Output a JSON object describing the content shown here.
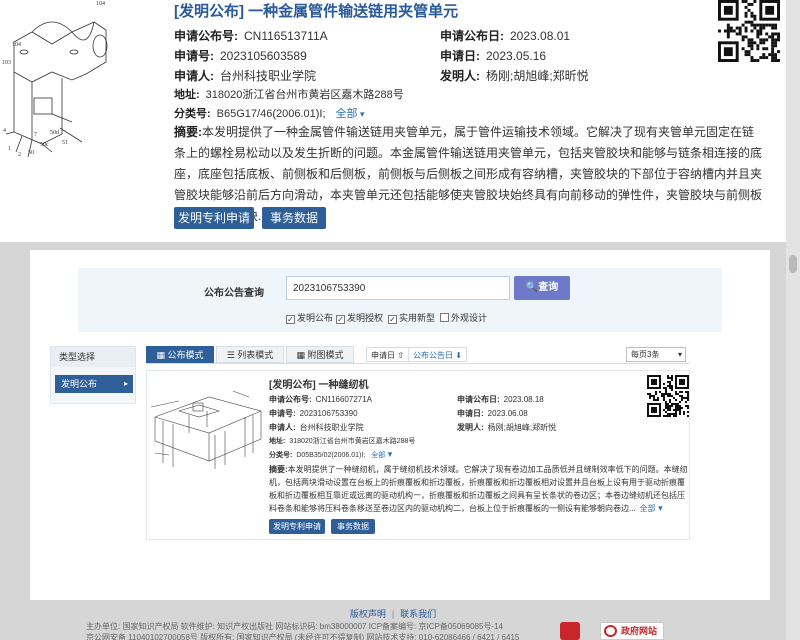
{
  "top": {
    "title": "[发明公布] 一种金属管件输送链用夹管单元",
    "pub_no_label": "申请公布号:",
    "pub_no": "CN116513711A",
    "pub_date_label": "申请公布日:",
    "pub_date": "2023.08.01",
    "app_no_label": "申请号:",
    "app_no": "2023105603589",
    "app_date_label": "申请日:",
    "app_date": "2023.05.16",
    "applicant_label": "申请人:",
    "applicant": "台州科技职业学院",
    "inventor_label": "发明人:",
    "inventor": "杨刚;胡旭峰;郑昕悦",
    "address_label": "地址:",
    "address": "318020浙江省台州市黄岩区嘉木路288号",
    "class_label": "分类号:",
    "class": "B65G17/46(2006.01)I;",
    "expand_all": "全部",
    "abstract_label": "摘要:",
    "abstract": "本发明提供了一种金属管件输送链用夹管单元，属于管件运输技术领域。它解决了现有夹管单元固定在链条上的螺栓易松动以及发生折断的问题。本金属管件输送链用夹管单元，包括夹管胶块和能够与链条相连接的底座，底座包括底板、前侧板和后侧板，前侧板与后侧板之间形成有容纳槽，夹管胶块的下部位于容纳槽内并且夹管胶块能够沿前后方向滑动，本夹管单元还包括能够使夹管胶块始终具有向前移动的弹性件，夹管胶块与前侧板相贴，夹管胶块...",
    "abstract_expand": "全部",
    "btn_apply": "发明专利申请",
    "btn_affairs": "事务数据",
    "diagram_labels": [
      "104",
      "104",
      "103",
      "4",
      "50d",
      "50c",
      "51",
      "2",
      "1",
      "50",
      "7"
    ]
  },
  "search": {
    "label": "公布公告查询",
    "value": "2023106753390",
    "button": "查询",
    "options": [
      {
        "label": "发明公布",
        "checked": true
      },
      {
        "label": "发明授权",
        "checked": true
      },
      {
        "label": "实用新型",
        "checked": true
      },
      {
        "label": "外观设计",
        "checked": false
      }
    ]
  },
  "sidebar": {
    "heading": "类型选择",
    "item": "发明公布"
  },
  "toolbar": {
    "tabs": [
      "公布模式",
      "列表模式",
      "附图模式"
    ],
    "sort_app_date": "申请日",
    "sort_pub_date": "公布公告日",
    "per_page": "每页3条"
  },
  "result": {
    "title": "[发明公布] 一种缝纫机",
    "pub_no_label": "申请公布号:",
    "pub_no": "CN116607271A",
    "pub_date_label": "申请公布日:",
    "pub_date": "2023.08.18",
    "app_no_label": "申请号:",
    "app_no": "2023106753390",
    "app_date_label": "申请日:",
    "app_date": "2023.06.08",
    "applicant_label": "申请人:",
    "applicant": "台州科技职业学院",
    "inventor_label": "发明人:",
    "inventor": "杨刚;胡旭峰;郑昕悦",
    "address_label": "地址:",
    "address": "318020浙江省台州市黄岩区嘉木路288号",
    "class_label": "分类号:",
    "class": "D05B35/02(2006.01)I;",
    "expand_all": "全部",
    "abstract_label": "摘要:",
    "abstract": "本发明提供了一种缝纫机，属于缝纫机技术领域。它解决了现有卷边加工品质低并且缝制效率低下的问题。本缝纫机，包括两块滑动设置在台板上的折痕覆板和折边覆板，折痕覆板和折边覆板相对设置并且台板上设有用于驱动折痕覆板和折边覆板相互靠近或远离的驱动机构一，折痕覆板和折边覆板之间具有呈长条状的卷边区；本卷边缝纫机还包括压料卷条和能够将压料卷条移送至卷边区内的驱动机构二，台板上位于折痕覆板的一侧设有能够朝向卷边...",
    "abstract_expand": "全部",
    "btn_apply": "发明专利申请",
    "btn_affairs": "事务数据"
  },
  "footer": {
    "link_copyright": "版权声明",
    "link_contact": "联系我们",
    "line1": "主办单位: 国家知识产权局   软件维护: 知识产权出版社   网站标识码: bm38000007   ICP备案编号: 京ICP备05069085号-14",
    "line2": "京公网安备 11040102700058号   版权所有: 国家知识产权局 (未经许可不得复制)   网站技术支持: 010-62086466 / 6421 / 6415",
    "gov_site": "政府网站"
  }
}
